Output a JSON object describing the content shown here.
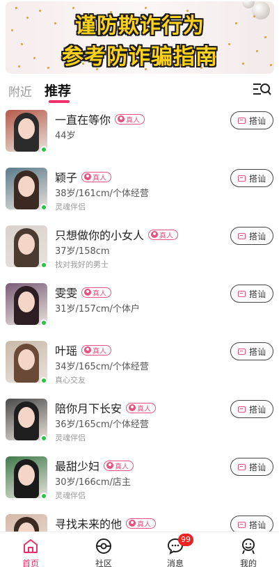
{
  "banner": {
    "line1": "谨防欺诈行为",
    "line2": "参考防诈骗指南"
  },
  "tabs": [
    {
      "label": "附近",
      "active": false
    },
    {
      "label": "推荐",
      "active": true
    }
  ],
  "chat_label": "搭讪",
  "verified_label": "真人",
  "users": [
    {
      "name": "一直在等你",
      "info": "44岁",
      "tag": "",
      "online": true,
      "avatar_colors": [
        "#b65a4a",
        "#2b2b2b"
      ]
    },
    {
      "name": "颖子",
      "info": "38岁/161cm/个体经营",
      "tag": "灵魂伴侣",
      "online": true,
      "avatar_colors": [
        "#5a7a8a",
        "#3a2a22"
      ]
    },
    {
      "name": "只想做你的小女人",
      "info": "37岁/158cm",
      "tag": "找对我好的男士",
      "online": true,
      "avatar_colors": [
        "#d9d2cc",
        "#4a3a30"
      ]
    },
    {
      "name": "雯雯",
      "info": "31岁/157cm/个体户",
      "tag": "",
      "online": true,
      "avatar_colors": [
        "#7a5c78",
        "#2c1e22"
      ]
    },
    {
      "name": "叶瑶",
      "info": "34岁/165cm/个体经营",
      "tag": "真心交友",
      "online": true,
      "avatar_colors": [
        "#c9b8a8",
        "#6a4a36"
      ]
    },
    {
      "name": "陪你月下长安",
      "info": "36岁/165cm/个体经营",
      "tag": "灵魂伴侣",
      "online": true,
      "avatar_colors": [
        "#4a4a4a",
        "#1e1e1e"
      ]
    },
    {
      "name": "最甜少妇",
      "info": "30岁/166cm/店主",
      "tag": "灵魂伴侣",
      "online": true,
      "avatar_colors": [
        "#3f7a4a",
        "#1a1a1a"
      ]
    },
    {
      "name": "寻找未来的他",
      "info": "",
      "tag": "",
      "online": false,
      "avatar_colors": [
        "#d6b8a8",
        "#3a2a22"
      ]
    }
  ],
  "bottom_nav": [
    {
      "label": "首页",
      "icon": "home-icon",
      "active": true
    },
    {
      "label": "社区",
      "icon": "community-icon",
      "active": false
    },
    {
      "label": "消息",
      "icon": "message-icon",
      "active": false,
      "badge": "99"
    },
    {
      "label": "我的",
      "icon": "profile-icon",
      "active": false
    }
  ],
  "colors": {
    "accent": "#f0306a",
    "verified": "#e8507d",
    "online": "#28c445",
    "badge": "#ec2222"
  }
}
